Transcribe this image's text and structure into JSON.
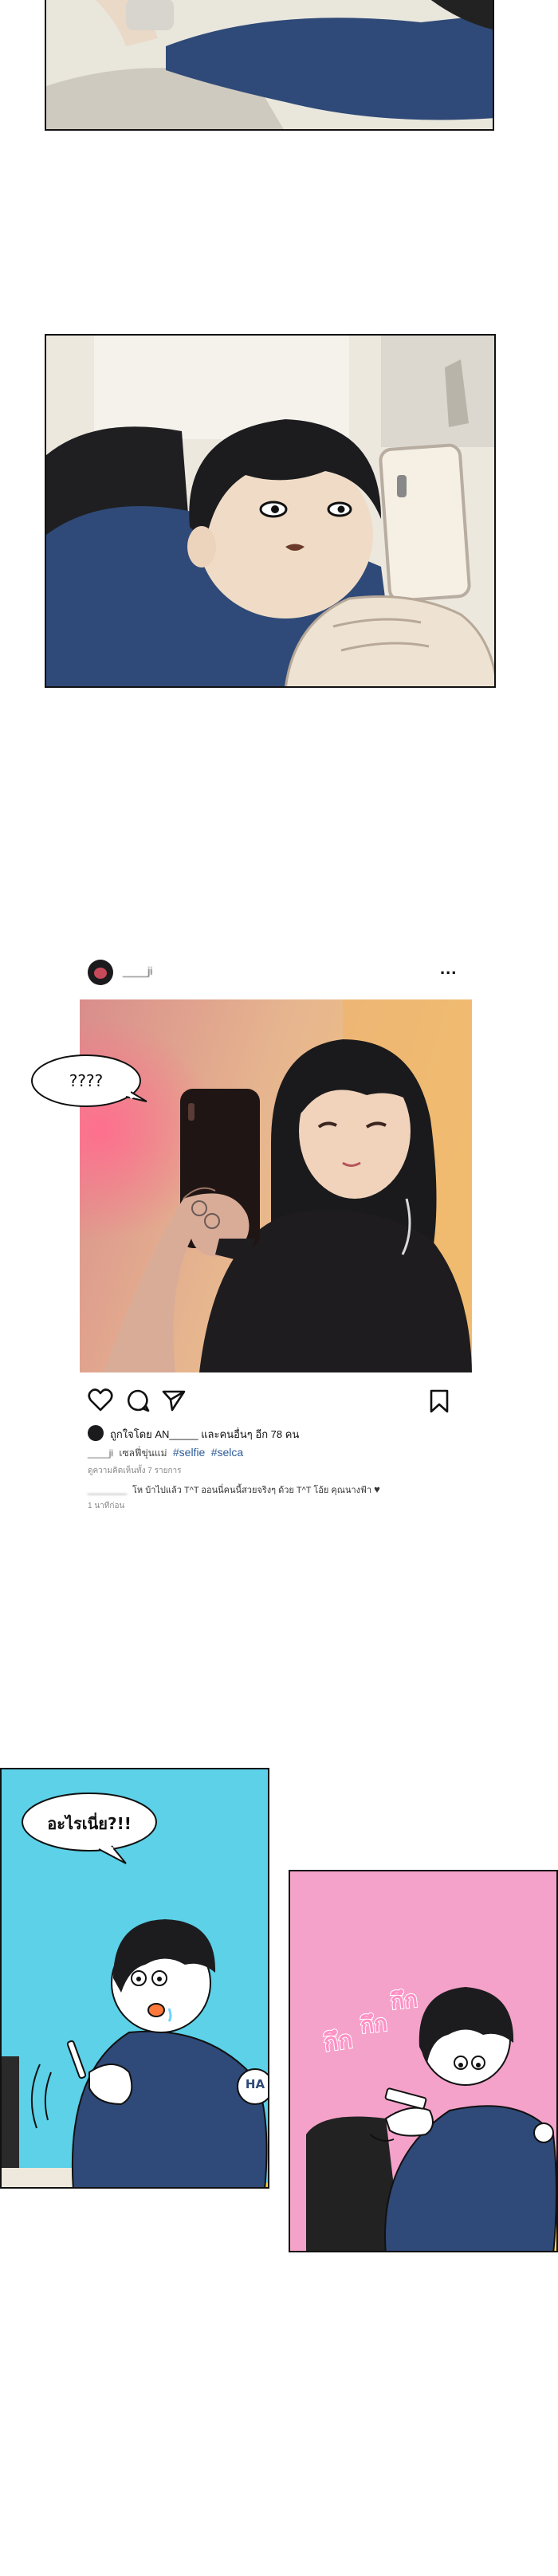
{
  "panel3": {
    "bubble_text": "????",
    "post": {
      "username": "____ji",
      "more_label": "...",
      "likes_line": "ถูกใจโดย AN_____ และคนอื่นๆ อีก 78 คน",
      "caption_user": "____ji",
      "caption_text": "เซลฟี่ขุ่นแม่",
      "hashtags": [
        "#selfie",
        "#selca"
      ],
      "view_comments": "ดูความคิดเห็นทั้ง 7 รายการ",
      "comment_user": "________",
      "comment_text": "โห บ้าไปแล้ว T^T ออนนี่คนนี้สวยจริงๆ ด้วย T^T โอ้ย คุณนางฟ้า",
      "comment_heart": "♥",
      "time_ago": "1 นาทีก่อน",
      "icons": [
        "heart-icon",
        "comment-icon",
        "share-icon",
        "bookmark-icon"
      ]
    }
  },
  "panel4": {
    "bubble_text": "อะไรเนี่ย?!!",
    "badge_text": "HA"
  },
  "panel5": {
    "sfx": [
      "กึก",
      "กึก",
      "กึก"
    ]
  },
  "colors": {
    "panel_border": "#111111",
    "jacket_navy": "#2f4a78",
    "panel4_bg": "#5cd1e8",
    "panel5_bg": "#f4a2c9",
    "hashtag_blue": "#2d5b99",
    "yellow": "#ffd83a"
  }
}
